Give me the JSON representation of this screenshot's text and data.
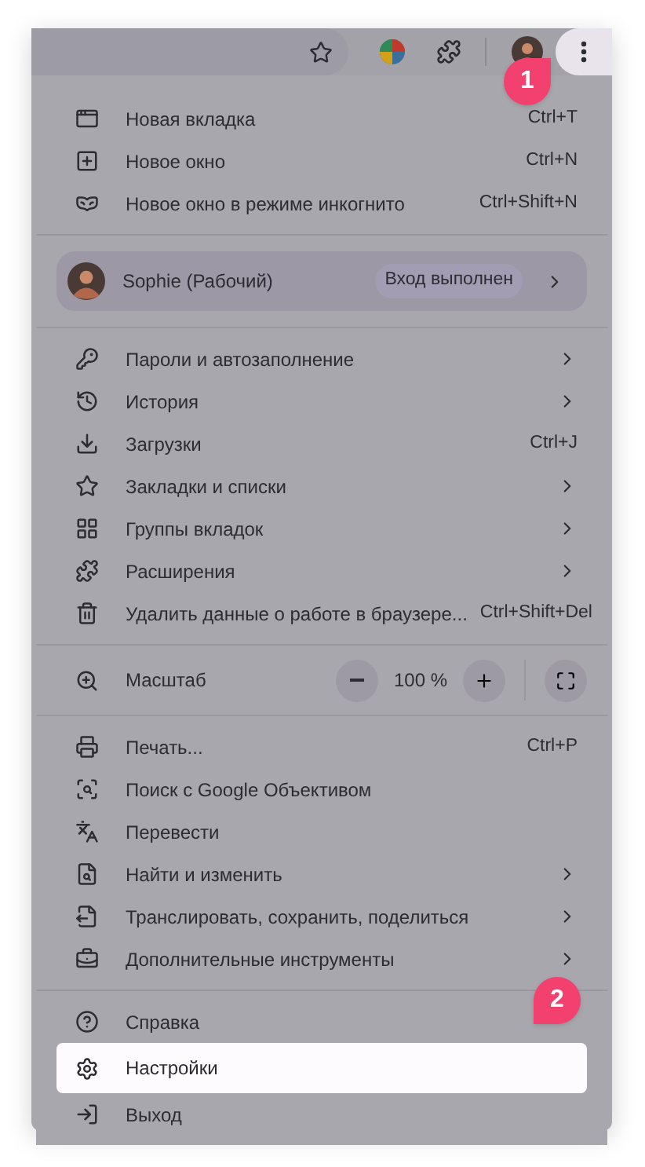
{
  "callouts": [
    "1",
    "2"
  ],
  "menu": {
    "sections": [
      {
        "items": [
          {
            "kind": "item",
            "label": "Новая вкладка",
            "shortcut": "Ctrl+T",
            "selected": false
          },
          {
            "kind": "item",
            "label": "Новое окно",
            "shortcut": "Ctrl+N",
            "selected": false
          },
          {
            "kind": "item",
            "label": "Новое окно в режиме инкогнито",
            "shortcut": "Ctrl+Shift+N",
            "selected": false
          }
        ]
      },
      {
        "items": [
          {
            "kind": "profile",
            "label": "Sophie (Рабочий)",
            "status": "Вход выполнен"
          }
        ]
      },
      {
        "items": [
          {
            "kind": "submenu",
            "label": "Пароли и автозаполнение",
            "selected": false
          },
          {
            "kind": "submenu",
            "label": "История",
            "selected": false
          },
          {
            "kind": "item",
            "label": "Загрузки",
            "shortcut": "Ctrl+J",
            "selected": false
          },
          {
            "kind": "submenu",
            "label": "Закладки и списки",
            "selected": false
          },
          {
            "kind": "submenu",
            "label": "Группы вкладок",
            "selected": false
          },
          {
            "kind": "submenu",
            "label": "Расширения",
            "selected": false
          },
          {
            "kind": "item",
            "label": "Удалить данные о работе в браузере...",
            "shortcut": "Ctrl+Shift+Del",
            "selected": false
          }
        ]
      },
      {
        "items": [
          {
            "kind": "zoom",
            "label": "Масштаб",
            "value": "100 %"
          }
        ]
      },
      {
        "items": [
          {
            "kind": "item",
            "label": "Печать...",
            "shortcut": "Ctrl+P",
            "selected": false
          },
          {
            "kind": "item",
            "label": "Поиск с Google Объективом",
            "selected": false
          },
          {
            "kind": "item",
            "label": "Перевести",
            "selected": false
          },
          {
            "kind": "submenu",
            "label": "Найти и изменить",
            "selected": false
          },
          {
            "kind": "submenu",
            "label": "Транслировать, сохранить, поделиться",
            "selected": false
          },
          {
            "kind": "submenu",
            "label": "Дополнительные инструменты",
            "selected": false
          }
        ]
      },
      {
        "items": [
          {
            "kind": "item",
            "label": "Справка",
            "selected": false
          },
          {
            "kind": "item",
            "label": "Настройки",
            "selected": true
          },
          {
            "kind": "item",
            "label": "Выход",
            "selected": false
          }
        ]
      }
    ]
  }
}
